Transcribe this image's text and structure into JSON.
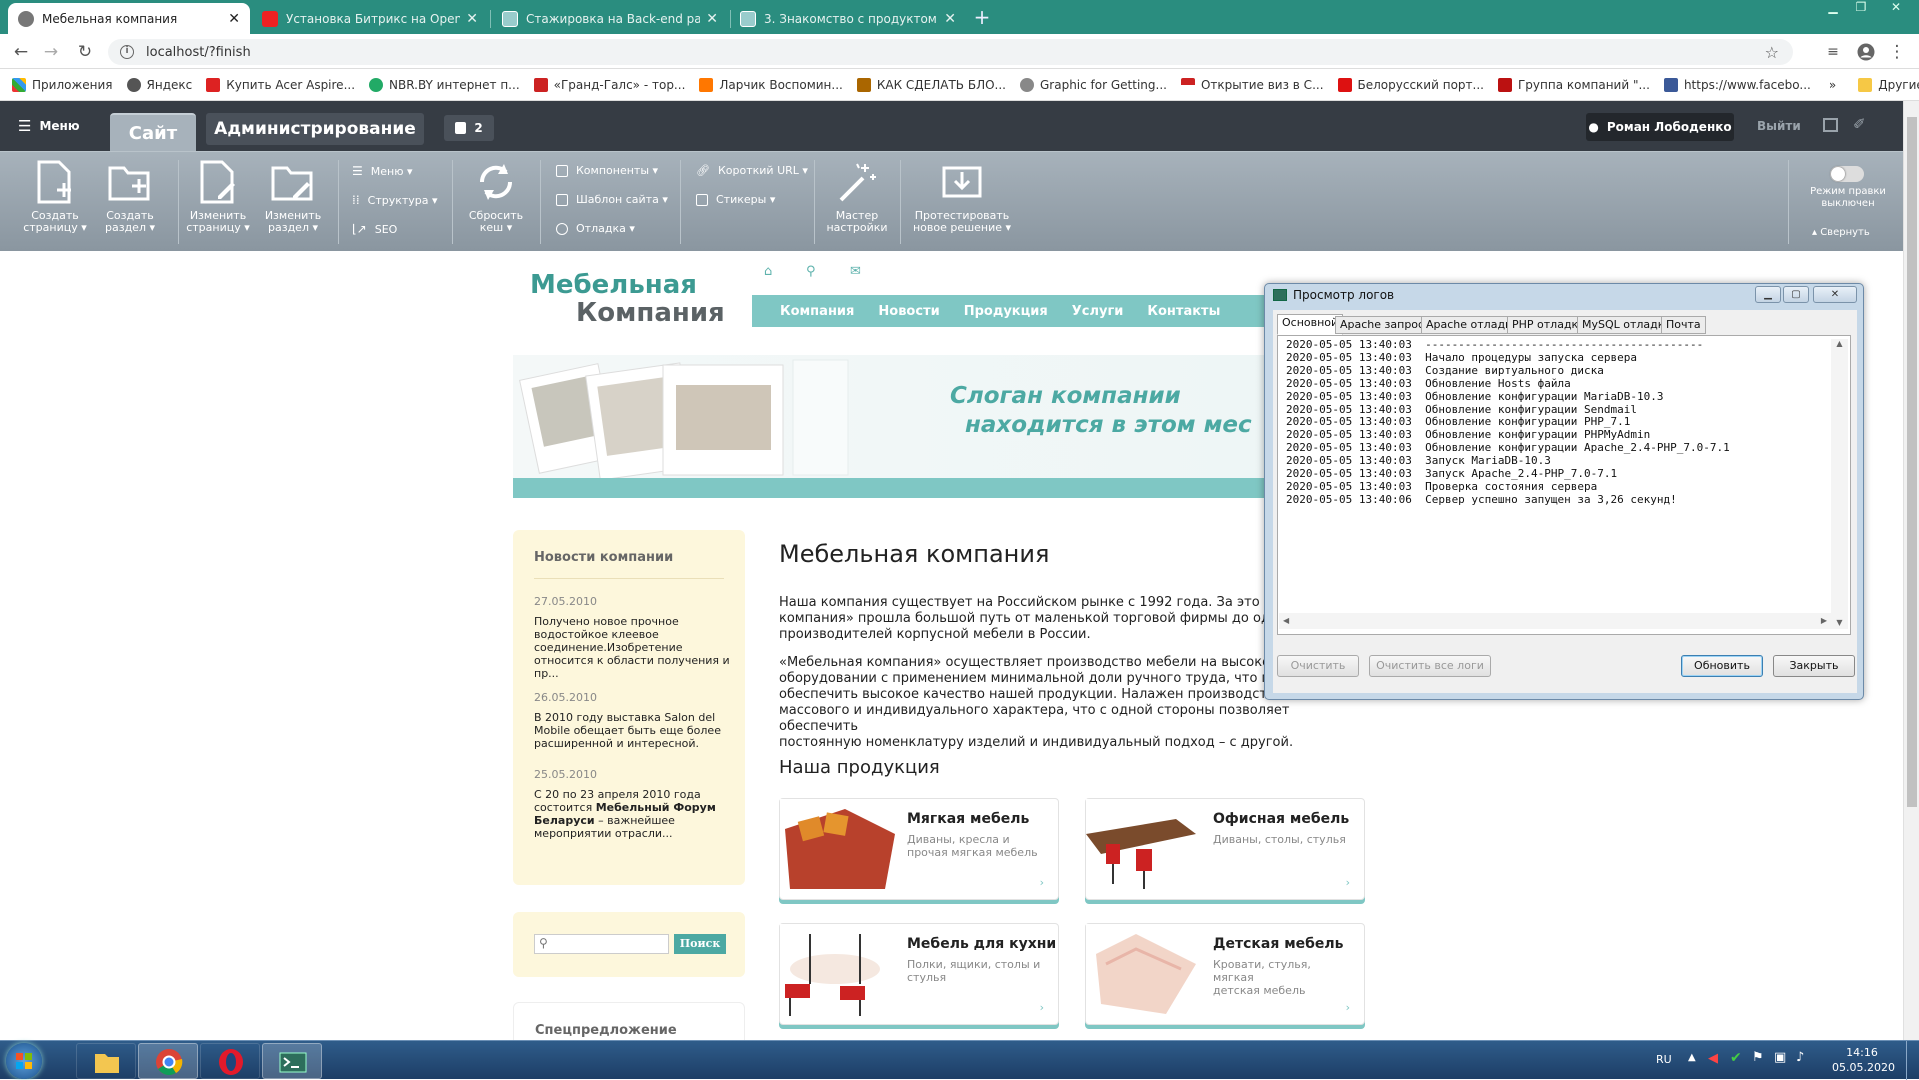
{
  "browser": {
    "tabs": [
      {
        "title": "Мебельная компания",
        "active": true
      },
      {
        "title": "Установка Битрикс на OpenServ",
        "active": false
      },
      {
        "title": "Стажировка на Back-end разра",
        "active": false
      },
      {
        "title": "3. Знакомство с продуктом",
        "active": false
      }
    ],
    "new_tab": "+",
    "url": "localhost/?finish",
    "bookmarks": [
      "Приложения",
      "Яндекс",
      "Купить Acer Aspire...",
      "NBR.BY интернет п...",
      "«Гранд-Галс» - тор...",
      "Ларчик Воспомин...",
      "КАК СДЕЛАТЬ БЛО...",
      "Graphic for Getting...",
      "Открытие виз в С...",
      "Белорусский порт...",
      "Группа компаний \"...",
      "https://www.facebo..."
    ],
    "bookmarks_more": "»",
    "other_bookmarks": "Другие закладки"
  },
  "bitrix": {
    "menu": "Меню",
    "tab_site": "Сайт",
    "tab_admin": "Администрирование",
    "notif_count": "2",
    "user": "Роман Лободенко",
    "logout": "Выйти",
    "tools": {
      "create_page": [
        "Создать",
        "страницу ▾"
      ],
      "create_section": [
        "Создать",
        "раздел ▾"
      ],
      "edit_page": [
        "Изменить",
        "страницу ▾"
      ],
      "edit_section": [
        "Изменить",
        "раздел ▾"
      ],
      "menu": "Меню ▾",
      "structure": "Структура ▾",
      "seo": "SEO",
      "reset_cache": [
        "Сбросить",
        "кеш ▾"
      ],
      "components": "Компоненты ▾",
      "template": "Шаблон сайта ▾",
      "debug": "Отладка ▾",
      "short_url": "Короткий URL ▾",
      "stickers": "Стикеры ▾",
      "wizard": [
        "Мастер",
        "настройки"
      ],
      "test_solution": [
        "Протестировать",
        "новое решение ▾"
      ],
      "edit_mode": [
        "Режим правки",
        "выключен"
      ],
      "collapse": "▴ Свернуть"
    }
  },
  "site": {
    "logo_line1": "Мебельная",
    "logo_line2": "Компания",
    "nav": [
      "Компания",
      "Новости",
      "Продукция",
      "Услуги",
      "Контакты"
    ],
    "slogan1": "Слоган компании",
    "slogan2": "находится в этом мес",
    "news_title": "Новости компании",
    "news": [
      {
        "date": "27.05.2010",
        "text1": "Получено новое прочное",
        "text2": "водостойкое клеевое",
        "text3": "соединение.Изобретение",
        "text4": "относится к области получения и",
        "text5": "пр..."
      },
      {
        "date": "26.05.2010",
        "text1": "В 2010 году выставка Salon del",
        "text2": "Mobile обещает быть еще более",
        "text3": "расширенной и интересной.",
        "text4": "",
        "text5": ""
      },
      {
        "date": "25.05.2010",
        "text1": "С 20 по 23 апреля 2010 года",
        "text2": "состоится ",
        "bold": "Мебельный Форум",
        "text3": "Беларуси",
        "text4": " – важнейшее",
        "text5": "мероприятии отрасли..."
      }
    ],
    "search_button": "Поиск",
    "special": "Спецпредложение",
    "heading": "Мебельная компания",
    "p1": [
      "Наша компания существует на Российском рынке с 1992 года. За это вр",
      "компания» прошла большой путь от маленькой торговой фирмы до одне",
      "производителей корпусной мебели в России."
    ],
    "p2": [
      "«Мебельная компания» осуществляет производство мебели на высокок",
      "оборудовании с применением минимальной доли ручного труда, что поз",
      "обеспечить высокое качество нашей продукции. Налажен производстве",
      "массового и индивидуального характера, что с одной стороны позволяет обеспечить",
      "постоянную номенклатуру изделий и индивидуальный подход – с другой."
    ],
    "products_title": "Наша продукция",
    "products": [
      {
        "title": "Мягкая мебель",
        "d1": "Диваны, кресла и",
        "d2": "прочая мягкая мебель"
      },
      {
        "title": "Офисная мебель",
        "d1": "Диваны, столы, стулья",
        "d2": ""
      },
      {
        "title": "Мебель для кухни",
        "d1": "Полки, ящики, столы и",
        "d2": "стулья"
      },
      {
        "title": "Детская мебель",
        "d1": "Кровати, стулья, мягкая",
        "d2": "детская мебель"
      }
    ],
    "arrow": "›"
  },
  "logviewer": {
    "title": "Просмотр логов",
    "tabs": [
      "Основной",
      "Apache запросы",
      "Apache отладка",
      "PHP отладка",
      "MySQL отладка",
      "Почта"
    ],
    "lines": [
      "2020-05-05 13:40:03  ------------------------------------------",
      "2020-05-05 13:40:03  Начало процедуры запуска сервера",
      "2020-05-05 13:40:03  Создание виртуального диска",
      "2020-05-05 13:40:03  Обновление Hosts файла",
      "2020-05-05 13:40:03  Обновление конфигурации MariaDB-10.3",
      "2020-05-05 13:40:03  Обновление конфигурации Sendmail",
      "2020-05-05 13:40:03  Обновление конфигурации PHP_7.1",
      "2020-05-05 13:40:03  Обновление конфигурации PHPMyAdmin",
      "2020-05-05 13:40:03  Обновление конфигурации Apache_2.4-PHP_7.0-7.1",
      "2020-05-05 13:40:03  Запуск MariaDB-10.3",
      "2020-05-05 13:40:03  Запуск Apache_2.4-PHP_7.0-7.1",
      "2020-05-05 13:40:03  Проверка состояния сервера",
      "2020-05-05 13:40:06  Сервер успешно запущен за 3,26 секунд!"
    ],
    "btn_clear": "Очистить",
    "btn_clear_all": "Очистить все логи",
    "btn_refresh": "Обновить",
    "btn_close": "Закрыть"
  },
  "taskbar": {
    "lang": "RU",
    "time": "14:16",
    "date": "05.05.2020"
  }
}
